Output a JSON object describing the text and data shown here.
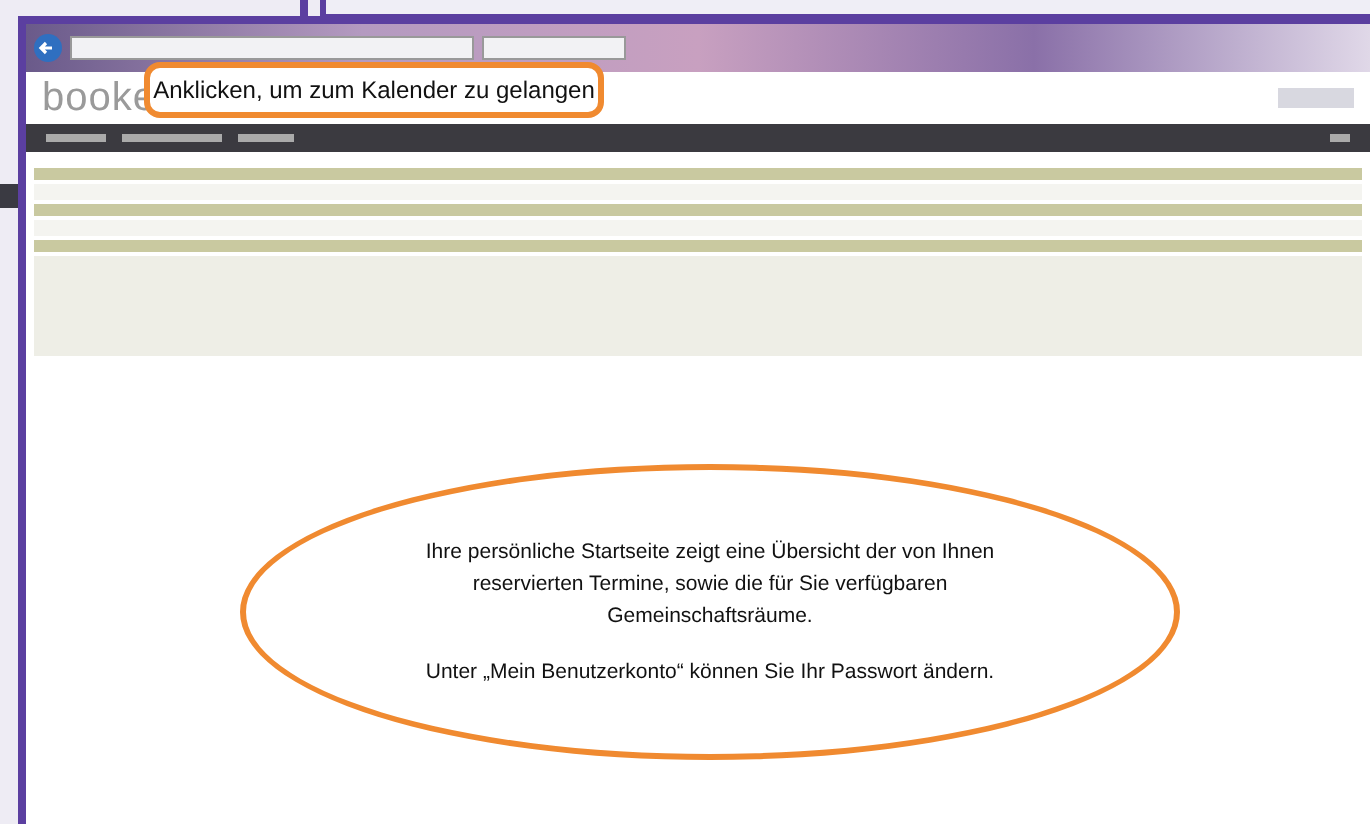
{
  "page": {
    "logo": "booke"
  },
  "callouts": [
    {
      "kind": "box",
      "text": "Anklicken, um zum Kalender zu gelangen"
    },
    {
      "kind": "ellipse",
      "paragraphs": [
        "Ihre persönliche Startseite zeigt eine Übersicht der von Ihnen reservierten Termine, sowie die für Sie verfügbaren Gemeinschaftsräume.",
        "Unter „Mein Benutzerkonto“ können Sie Ihr Passwort ändern."
      ]
    }
  ]
}
